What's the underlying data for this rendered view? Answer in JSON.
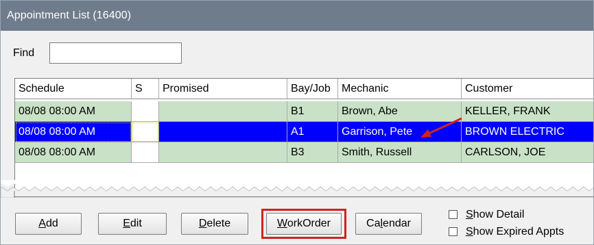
{
  "window": {
    "title": "Appointment List (16400)"
  },
  "find": {
    "label": "Find",
    "value": ""
  },
  "grid": {
    "columns": [
      "Schedule",
      "S",
      "Promised",
      "Bay/Job",
      "Mechanic",
      "Customer"
    ],
    "rows": [
      {
        "schedule": "08/08 08:00 AM",
        "s": "",
        "promised": "",
        "bay": "B1",
        "mechanic": "Brown, Abe",
        "customer": "KELLER, FRANK",
        "state": "normal"
      },
      {
        "schedule": "08/08 08:00 AM",
        "s": "",
        "promised": "",
        "bay": "A1",
        "mechanic": "Garrison, Pete",
        "customer": "BROWN ELECTRIC",
        "state": "selected"
      },
      {
        "schedule": "08/08 08:00 AM",
        "s": "",
        "promised": "",
        "bay": "B3",
        "mechanic": "Smith, Russell",
        "customer": "CARLSON, JOE",
        "state": "normal"
      }
    ]
  },
  "buttons": {
    "add": {
      "mnemonic": "A",
      "rest": "dd"
    },
    "edit": {
      "mnemonic": "E",
      "rest": "dit"
    },
    "delete": {
      "mnemonic": "D",
      "rest": "elete"
    },
    "workorder": {
      "mnemonic": "W",
      "rest": "orkOrder"
    },
    "calendar": {
      "pre": "Ca",
      "mnemonic": "l",
      "rest": "endar"
    }
  },
  "checkboxes": {
    "show_detail": {
      "mnemonic": "S",
      "rest": "how Detail",
      "checked": false
    },
    "show_expired": {
      "mnemonic": "S",
      "rest": "how Expired Appts",
      "checked": false
    }
  },
  "colors": {
    "titlebar": "#6f7c8c",
    "row_green": "#c9e2c7",
    "row_selected": "#0000ff",
    "highlight_box": "#d0231f",
    "arrow": "#d0231f"
  }
}
